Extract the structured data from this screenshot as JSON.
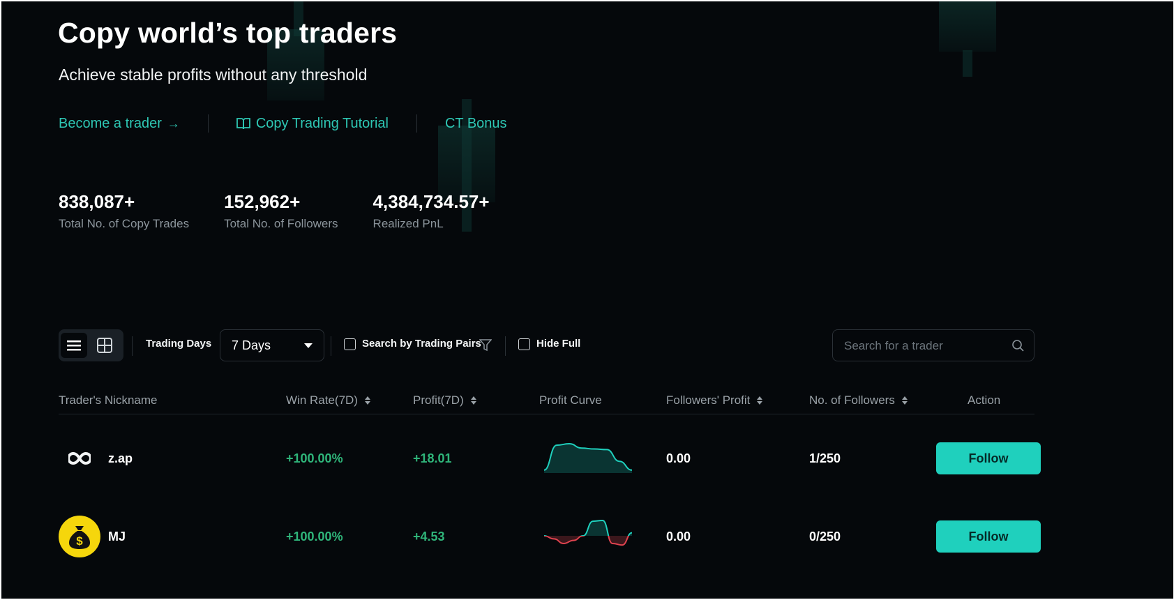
{
  "hero": {
    "title": "Copy world’s top traders",
    "subtitle": "Achieve stable profits without any threshold"
  },
  "links": [
    {
      "label": "Become a trader",
      "icon": "arrow-right-icon"
    },
    {
      "label": "Copy Trading Tutorial",
      "icon": "book-icon"
    },
    {
      "label": "CT Bonus"
    }
  ],
  "stats": [
    {
      "value": "838,087+",
      "label": "Total No. of Copy Trades"
    },
    {
      "value": "152,962+",
      "label": "Total No. of Followers"
    },
    {
      "value": "4,384,734.57+",
      "label": "Realized PnL"
    }
  ],
  "toolbar": {
    "trading_days_label": "Trading Days",
    "trading_days_value": "7 Days",
    "search_pairs_label": "Search by Trading Pairs",
    "hide_full_label": "Hide Full",
    "search_placeholder": "Search for a trader"
  },
  "table": {
    "headers": [
      "Trader's Nickname",
      "Win Rate(7D)",
      "Profit(7D)",
      "Profit Curve",
      "Followers' Profit",
      "No. of Followers",
      "Action"
    ],
    "rows": [
      {
        "nickname": "z.ap",
        "win_rate": "+100.00%",
        "profit": "+18.01",
        "followers_profit": "0.00",
        "followers": "1/250",
        "action": "Follow",
        "curve": [
          0.1,
          0.95,
          1.0,
          0.85,
          0.82,
          0.8,
          0.4,
          0.1
        ]
      },
      {
        "nickname": "MJ",
        "win_rate": "+100.00%",
        "profit": "+4.53",
        "followers_profit": "0.00",
        "followers": "0/250",
        "action": "Follow",
        "curve": [
          0.0,
          -0.2,
          -0.5,
          -0.3,
          0.0,
          0.95,
          1.0,
          -0.5,
          -0.6,
          0.2
        ]
      }
    ]
  },
  "colors": {
    "accent": "#2ec7b4",
    "button": "#1fd0bd",
    "positive": "#2fb57a",
    "negative": "#e0434f",
    "background": "#05080b"
  }
}
